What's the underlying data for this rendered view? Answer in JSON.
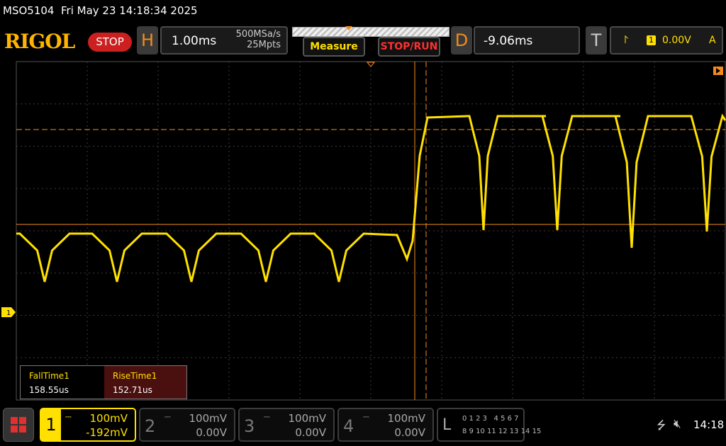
{
  "status": {
    "model": "MSO5104",
    "datetime": "Fri May 23 14:18:34 2025"
  },
  "header": {
    "logo": "RIGOL",
    "run_state": "STOP",
    "horizontal": {
      "letter": "H",
      "timebase": "1.00ms",
      "sample_rate": "500MSa/s",
      "memory_depth": "25Mpts"
    },
    "measure_label": "Measure",
    "stoprun_label": "STOP/RUN",
    "delay": {
      "letter": "D",
      "value": "-9.06ms"
    },
    "trigger": {
      "letter": "T",
      "source_channel": "1",
      "level": "0.00V",
      "mode": "A"
    }
  },
  "screen": {
    "channel_marker": "1",
    "colors": {
      "ch1": "#ffe000",
      "cursor": "#f28c1b",
      "grid": "#444444",
      "background": "#000000"
    }
  },
  "measurements": [
    {
      "name": "FallTime1",
      "value": "158.55us"
    },
    {
      "name": "RiseTime1",
      "value": "152.71us"
    }
  ],
  "channels": [
    {
      "num": "1",
      "scale": "100mV",
      "offset": "-192mV",
      "active": true
    },
    {
      "num": "2",
      "scale": "100mV",
      "offset": "0.00V",
      "active": false
    },
    {
      "num": "3",
      "scale": "100mV",
      "offset": "0.00V",
      "active": false
    },
    {
      "num": "4",
      "scale": "100mV",
      "offset": "0.00V",
      "active": false
    }
  ],
  "logic": {
    "label": "L",
    "row1": "0 1 2 3   4 5 6 7",
    "row2": "8 9 10 11 12 13 14 15"
  },
  "system": {
    "time": "14:18",
    "icons": [
      "usb-icon",
      "mute-icon"
    ]
  }
}
